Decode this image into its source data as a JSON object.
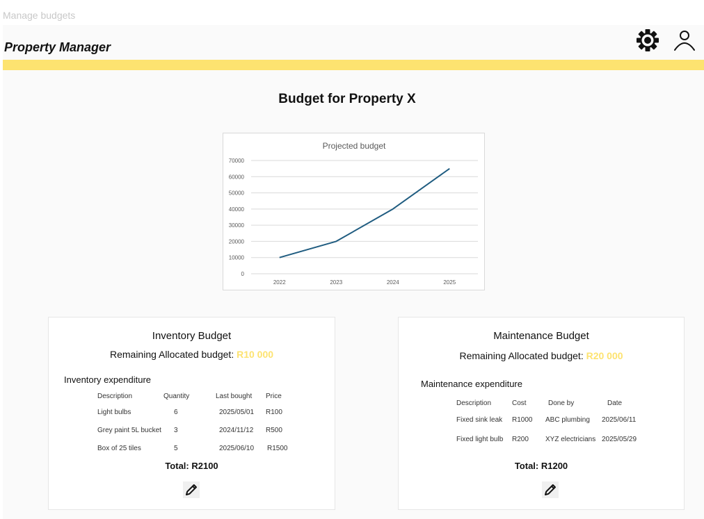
{
  "frame_label": "Manage budgets",
  "header": {
    "title": "Property Manager",
    "settings_icon": "gear-icon",
    "user_icon": "user-icon",
    "accent_color": "#fde370"
  },
  "page": {
    "title": "Budget for Property X"
  },
  "chart_data": {
    "type": "line",
    "title": "Projected budget",
    "xlabel": "",
    "ylabel": "",
    "categories": [
      "2022",
      "2023",
      "2024",
      "2025"
    ],
    "series": [
      {
        "values": [
          10000,
          20000,
          40000,
          65000
        ],
        "color": "#1f5c80"
      }
    ],
    "ylim": [
      0,
      70000
    ],
    "yticks": [
      "0",
      "10000",
      "20000",
      "30000",
      "40000",
      "50000",
      "60000",
      "70000"
    ],
    "grid": true
  },
  "inventory": {
    "title": "Inventory Budget",
    "remaining_label": "Remaining Allocated budget:",
    "remaining_amount": "R10 000",
    "section_label": "Inventory expenditure",
    "columns": [
      "Description",
      "Quantity",
      "Last bought",
      "Price"
    ],
    "rows": [
      [
        "Light bulbs",
        "6",
        "2025/05/01",
        "R100"
      ],
      [
        "Grey paint 5L bucket",
        "3",
        "2024/11/12",
        "R500"
      ],
      [
        "Box of 25 tiles",
        "5",
        "2025/06/10",
        "R1500"
      ]
    ],
    "total": "Total: R2100",
    "edit_icon": "pencil-icon"
  },
  "maintenance": {
    "title": "Maintenance  Budget",
    "remaining_label": "Remaining Allocated budget:",
    "remaining_amount": "R20 000",
    "section_label": "Maintenance expenditure",
    "columns": [
      "Description",
      "Cost",
      "Done by",
      "Date"
    ],
    "rows": [
      [
        "Fixed sink leak",
        "R1000",
        "ABC plumbing",
        "2025/06/11"
      ],
      [
        "Fixed light bulb",
        "R200",
        "XYZ electricians",
        "2025/05/29"
      ]
    ],
    "total": "Total: R1200",
    "edit_icon": "pencil-icon"
  }
}
